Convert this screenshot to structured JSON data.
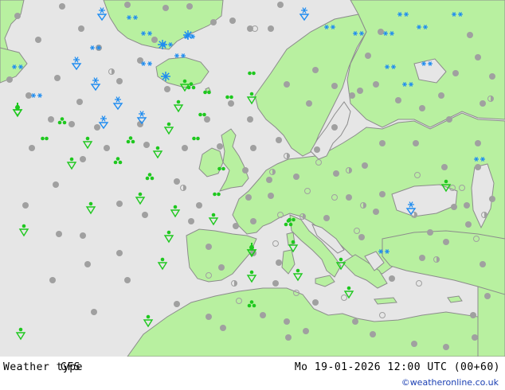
{
  "footer": {
    "title": "Weather type",
    "model": "GFS",
    "valid_time": "Mo 19-01-2026 12:00 UTC (00+60)",
    "credit": "©weatheronline.co.uk"
  },
  "colors": {
    "sea": "#e6e6e6",
    "land": "#b8f0a0",
    "coast": "#8c8c8c",
    "border": "#8c8c8c",
    "cloud": "#a0a0a0",
    "rain": "#1ec81e",
    "snow": "#1e8cf0"
  },
  "legend_symbols": [
    "cloud-dot",
    "light-cloud-dot",
    "drizzle",
    "rain-shower",
    "thunderstorm",
    "snow",
    "snow-shower"
  ]
}
